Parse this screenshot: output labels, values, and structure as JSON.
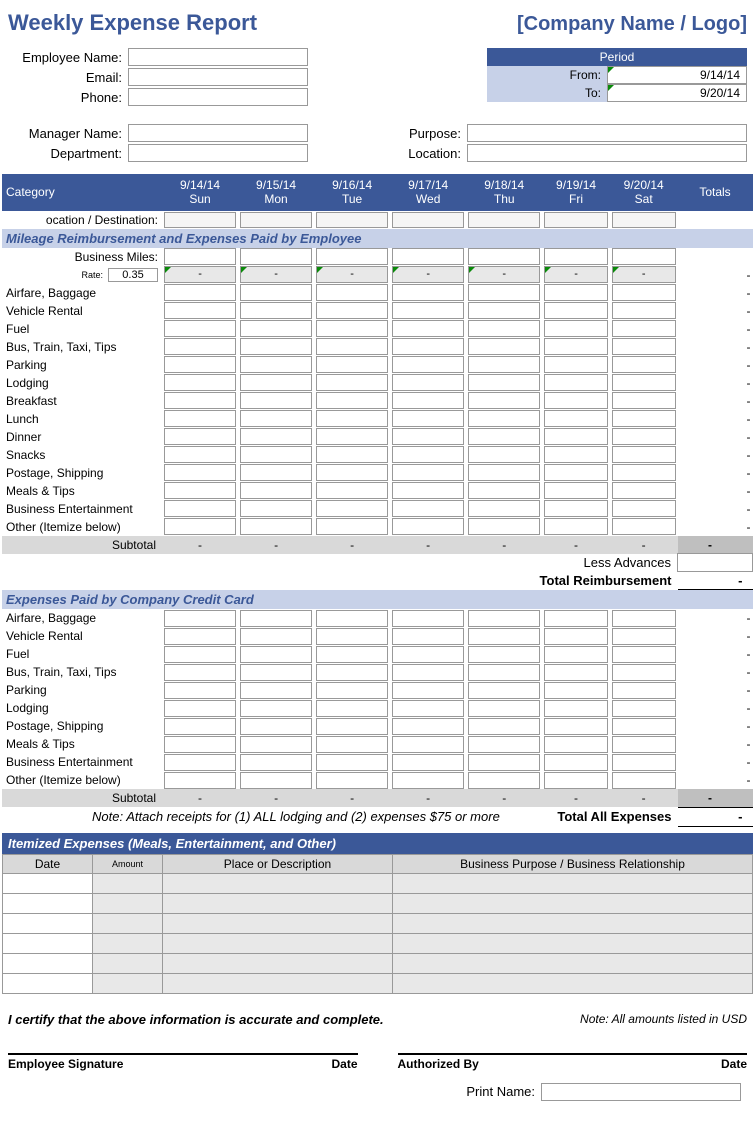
{
  "title": "Weekly Expense Report",
  "company": "[Company Name / Logo]",
  "employee": {
    "name_label": "Employee Name:",
    "email_label": "Email:",
    "phone_label": "Phone:",
    "manager_label": "Manager Name:",
    "department_label": "Department:"
  },
  "period": {
    "header": "Period",
    "from_label": "From:",
    "to_label": "To:",
    "from_value": "9/14/14",
    "to_value": "9/20/14"
  },
  "purpose_label": "Purpose:",
  "location_label": "Location:",
  "columns": {
    "category": "Category",
    "totals": "Totals",
    "days": [
      {
        "date": "9/14/14",
        "dow": "Sun"
      },
      {
        "date": "9/15/14",
        "dow": "Mon"
      },
      {
        "date": "9/16/14",
        "dow": "Tue"
      },
      {
        "date": "9/17/14",
        "dow": "Wed"
      },
      {
        "date": "9/18/14",
        "dow": "Thu"
      },
      {
        "date": "9/19/14",
        "dow": "Fri"
      },
      {
        "date": "9/20/14",
        "dow": "Sat"
      }
    ]
  },
  "location_dest_label": "ocation / Destination:",
  "section1": {
    "header": "Mileage Reimbursement and Expenses Paid by Employee",
    "business_miles": "Business Miles:",
    "rate_label": "Rate:",
    "rate_value": "0.35",
    "categories": [
      "Airfare, Baggage",
      "Vehicle Rental",
      "Fuel",
      "Bus, Train, Taxi, Tips",
      "Parking",
      "Lodging",
      "Breakfast",
      "Lunch",
      "Dinner",
      "Snacks",
      "Postage, Shipping",
      "Meals & Tips",
      "Business Entertainment",
      "Other (Itemize below)"
    ],
    "subtotal_label": "Subtotal",
    "less_advances": "Less Advances",
    "total_reimb": "Total Reimbursement"
  },
  "section2": {
    "header": "Expenses Paid by Company Credit Card",
    "categories": [
      "Airfare, Baggage",
      "Vehicle Rental",
      "Fuel",
      "Bus, Train, Taxi, Tips",
      "Parking",
      "Lodging",
      "Postage, Shipping",
      "Meals & Tips",
      "Business Entertainment",
      "Other (Itemize below)"
    ],
    "subtotal_label": "Subtotal",
    "note": "Note:  Attach receipts for (1) ALL lodging and (2) expenses $75 or more",
    "total_all": "Total All Expenses"
  },
  "itemized": {
    "header": "Itemized Expenses (Meals, Entertainment, and Other)",
    "col_date": "Date",
    "col_amount": "Amount",
    "col_place": "Place or Description",
    "col_purpose": "Business Purpose / Business Relationship"
  },
  "certify_text": "I certify that the above information is accurate and complete.",
  "usd_note": "Note: All amounts listed in USD",
  "sig": {
    "employee": "Employee Signature",
    "date": "Date",
    "authorized": "Authorized By",
    "print_name": "Print Name:"
  },
  "dash": "-"
}
